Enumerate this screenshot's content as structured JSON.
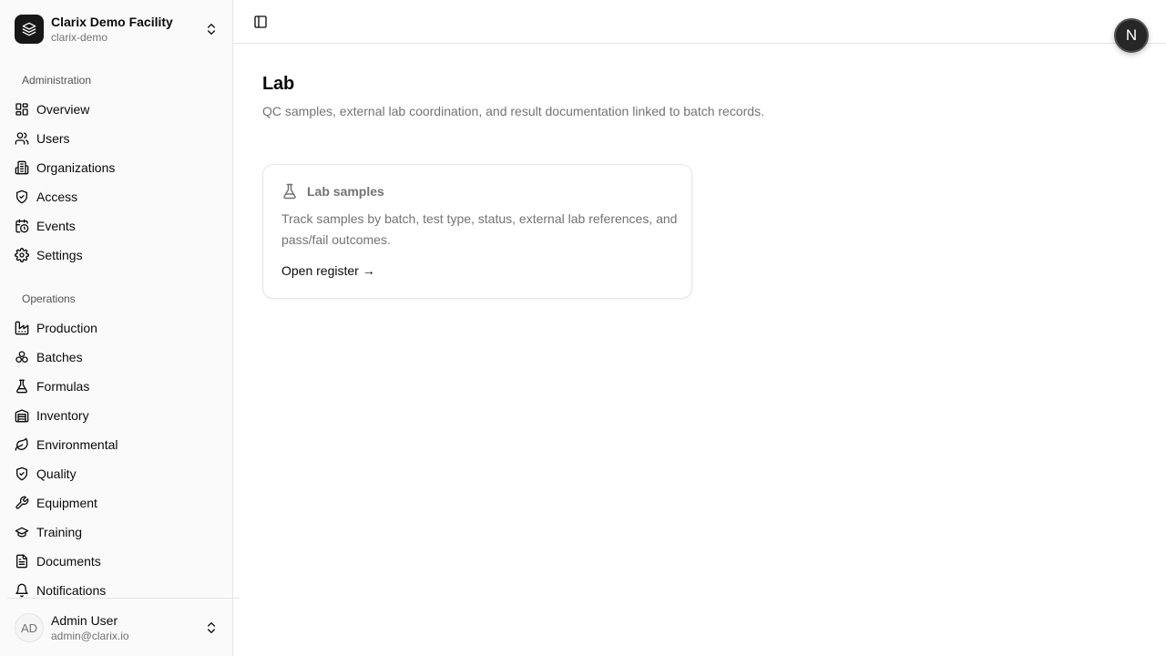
{
  "org": {
    "name": "Clarix Demo Facility",
    "slug": "clarix-demo"
  },
  "sidebar": {
    "groups": [
      {
        "label": "Administration",
        "items": [
          {
            "label": "Overview",
            "icon": "layout-grid-icon"
          },
          {
            "label": "Users",
            "icon": "users-icon"
          },
          {
            "label": "Organizations",
            "icon": "building-icon"
          },
          {
            "label": "Access",
            "icon": "shield-check-icon"
          },
          {
            "label": "Events",
            "icon": "calendar-clock-icon"
          },
          {
            "label": "Settings",
            "icon": "gear-icon"
          }
        ]
      },
      {
        "label": "Operations",
        "items": [
          {
            "label": "Production",
            "icon": "factory-icon"
          },
          {
            "label": "Batches",
            "icon": "boxes-icon"
          },
          {
            "label": "Formulas",
            "icon": "flask-icon"
          },
          {
            "label": "Inventory",
            "icon": "warehouse-icon"
          },
          {
            "label": "Environmental",
            "icon": "leaf-icon"
          },
          {
            "label": "Quality",
            "icon": "shield-check-icon"
          },
          {
            "label": "Equipment",
            "icon": "wrench-icon"
          },
          {
            "label": "Training",
            "icon": "graduation-cap-icon"
          },
          {
            "label": "Documents",
            "icon": "file-text-icon"
          },
          {
            "label": "Notifications",
            "icon": "bell-icon"
          }
        ]
      }
    ]
  },
  "user": {
    "initials": "AD",
    "name": "Admin User",
    "email": "admin@clarix.io"
  },
  "floating_avatar": {
    "letter": "N"
  },
  "page": {
    "title": "Lab",
    "description": "QC samples, external lab coordination, and result documentation linked to batch records."
  },
  "card": {
    "icon": "flask-icon",
    "title": "Lab samples",
    "description": "Track samples by batch, test type, status, external lab references, and pass/fail outcomes.",
    "link": "Open register →"
  }
}
